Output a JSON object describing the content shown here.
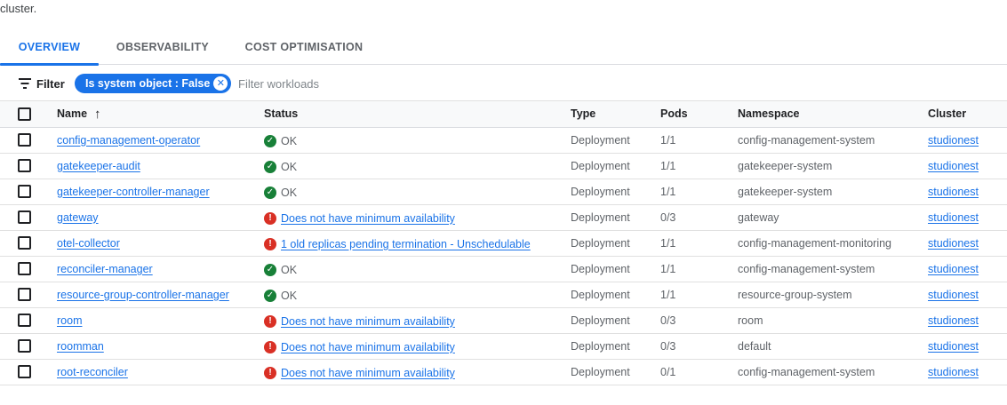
{
  "intro_text": "cluster.",
  "tabs": [
    {
      "label": "OVERVIEW",
      "active": true
    },
    {
      "label": "OBSERVABILITY",
      "active": false
    },
    {
      "label": "COST OPTIMISATION",
      "active": false
    }
  ],
  "filter": {
    "label": "Filter",
    "chip": "Is system object : False",
    "placeholder": "Filter workloads"
  },
  "table": {
    "headers": {
      "name": "Name",
      "status": "Status",
      "type": "Type",
      "pods": "Pods",
      "namespace": "Namespace",
      "cluster": "Cluster"
    },
    "rows": [
      {
        "name": "config-management-operator",
        "status": "OK",
        "status_kind": "ok",
        "type": "Deployment",
        "pods": "1/1",
        "namespace": "config-management-system",
        "cluster": "studionest"
      },
      {
        "name": "gatekeeper-audit",
        "status": "OK",
        "status_kind": "ok",
        "type": "Deployment",
        "pods": "1/1",
        "namespace": "gatekeeper-system",
        "cluster": "studionest"
      },
      {
        "name": "gatekeeper-controller-manager",
        "status": "OK",
        "status_kind": "ok",
        "type": "Deployment",
        "pods": "1/1",
        "namespace": "gatekeeper-system",
        "cluster": "studionest"
      },
      {
        "name": "gateway",
        "status": "Does not have minimum availability",
        "status_kind": "error",
        "type": "Deployment",
        "pods": "0/3",
        "namespace": "gateway",
        "cluster": "studionest"
      },
      {
        "name": "otel-collector",
        "status": "1 old replicas pending termination - Unschedulable",
        "status_kind": "error",
        "type": "Deployment",
        "pods": "1/1",
        "namespace": "config-management-monitoring",
        "cluster": "studionest"
      },
      {
        "name": "reconciler-manager",
        "status": "OK",
        "status_kind": "ok",
        "type": "Deployment",
        "pods": "1/1",
        "namespace": "config-management-system",
        "cluster": "studionest"
      },
      {
        "name": "resource-group-controller-manager",
        "status": "OK",
        "status_kind": "ok",
        "type": "Deployment",
        "pods": "1/1",
        "namespace": "resource-group-system",
        "cluster": "studionest"
      },
      {
        "name": "room",
        "status": "Does not have minimum availability",
        "status_kind": "error",
        "type": "Deployment",
        "pods": "0/3",
        "namespace": "room",
        "cluster": "studionest"
      },
      {
        "name": "roomman",
        "status": "Does not have minimum availability",
        "status_kind": "error",
        "type": "Deployment",
        "pods": "0/3",
        "namespace": "default",
        "cluster": "studionest"
      },
      {
        "name": "root-reconciler",
        "status": "Does not have minimum availability",
        "status_kind": "error",
        "type": "Deployment",
        "pods": "0/1",
        "namespace": "config-management-system",
        "cluster": "studionest"
      }
    ]
  },
  "colors": {
    "accent": "#1a73e8",
    "ok": "#188038",
    "error": "#d93025"
  }
}
